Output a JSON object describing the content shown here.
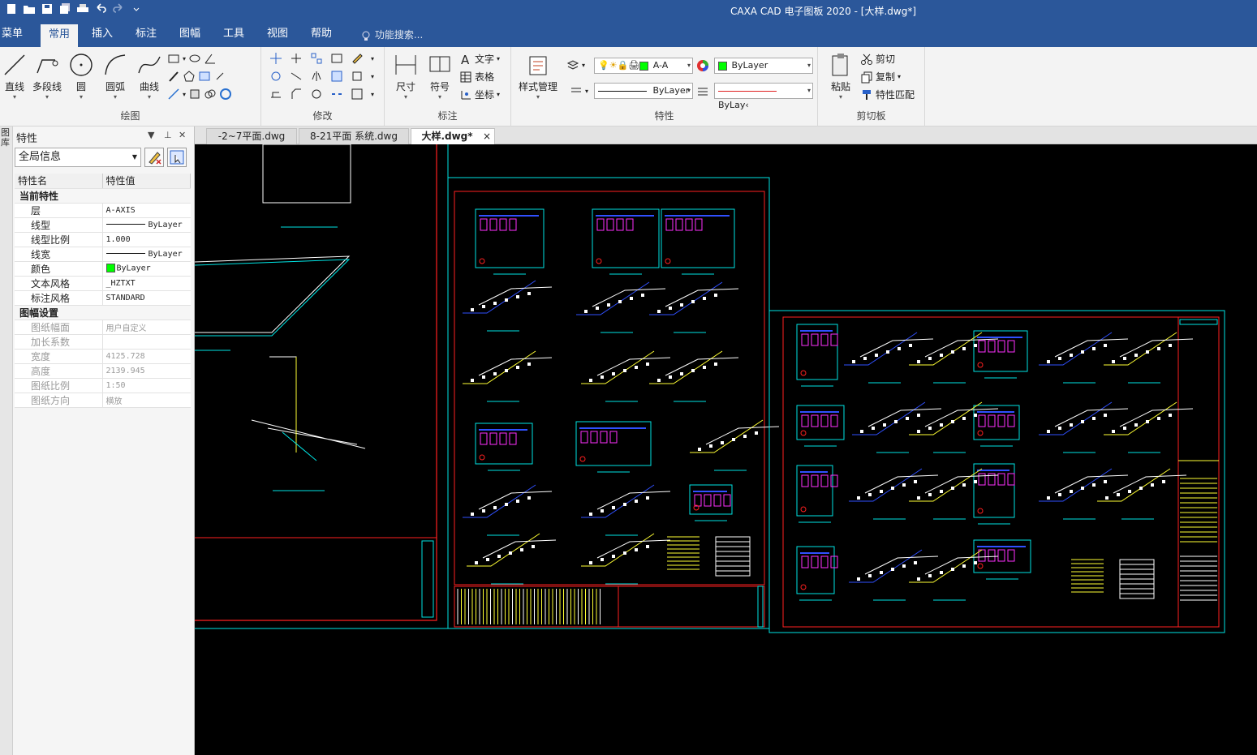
{
  "window": {
    "title": "CAXA CAD 电子图板 2020 - [大样.dwg*]"
  },
  "menu": {
    "tabs": [
      {
        "label": "菜单"
      },
      {
        "label": "常用"
      },
      {
        "label": "插入"
      },
      {
        "label": "标注"
      },
      {
        "label": "图幅"
      },
      {
        "label": "工具"
      },
      {
        "label": "视图"
      },
      {
        "label": "帮助"
      }
    ],
    "active_tab": "常用",
    "search_placeholder": "功能搜索..."
  },
  "ribbon": {
    "draw": {
      "label": "绘图",
      "buttons": [
        "直线",
        "多段线",
        "圆",
        "圆弧",
        "曲线"
      ]
    },
    "modify": {
      "label": "修改"
    },
    "annotate": {
      "label": "标注",
      "buttons": [
        "尺寸",
        "符号"
      ],
      "small": [
        "文字",
        "表格",
        "坐标"
      ]
    },
    "properties": {
      "label": "特性",
      "style_manager": "样式管理",
      "layer": "A-A",
      "color": "ByLayer",
      "linetype": "ByLayer",
      "linewidth": "ByLay‹"
    },
    "clipboard": {
      "label": "剪切板",
      "paste": "粘贴",
      "small": [
        "剪切",
        "复制",
        "特性匹配"
      ]
    }
  },
  "panel": {
    "title": "特性",
    "side_label": "图库",
    "selection": "全局信息",
    "columns": [
      "特性名",
      "特性值"
    ],
    "sections": [
      {
        "name": "当前特性",
        "disabled": false,
        "rows": [
          {
            "k": "层",
            "v": "A-AXIS"
          },
          {
            "k": "线型",
            "v": "ByLayer",
            "line": true
          },
          {
            "k": "线型比例",
            "v": "1.000"
          },
          {
            "k": "线宽",
            "v": "ByLayer",
            "line": true
          },
          {
            "k": "颜色",
            "v": "ByLayer",
            "swatch": true
          },
          {
            "k": "文本风格",
            "v": "_HZTXT"
          },
          {
            "k": "标注风格",
            "v": "STANDARD"
          }
        ]
      },
      {
        "name": "图幅设置",
        "disabled": true,
        "rows": [
          {
            "k": "图纸幅面",
            "v": "用户自定义"
          },
          {
            "k": "加长系数",
            "v": ""
          },
          {
            "k": "宽度",
            "v": "4125.728"
          },
          {
            "k": "高度",
            "v": "2139.945"
          },
          {
            "k": "图纸比例",
            "v": "1:50"
          },
          {
            "k": "图纸方向",
            "v": "横放"
          }
        ]
      }
    ]
  },
  "documents": {
    "tabs": [
      {
        "label": "-2~7平面.dwg"
      },
      {
        "label": "8-21平面 系统.dwg"
      },
      {
        "label": "大样.dwg*"
      }
    ],
    "active": "大样.dwg*"
  },
  "colors": {
    "accent": "#2b579a",
    "canvas": "#000000",
    "cad_cyan": "#00e5e5",
    "cad_red": "#ff2020",
    "cad_yellow": "#ffff33",
    "cad_white": "#ffffff",
    "cad_blue": "#3050ff",
    "cad_magenta": "#ff30ff",
    "cad_green": "#30ff30"
  }
}
